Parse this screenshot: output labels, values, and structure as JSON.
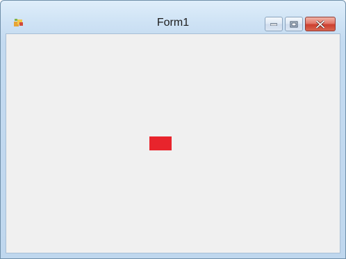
{
  "window": {
    "title": "Form1"
  },
  "icons": {
    "app": "app-icon",
    "minimize": "minimize-icon",
    "maximize": "maximize-icon",
    "close": "close-icon"
  },
  "colors": {
    "red_rectangle": "#e8242c",
    "client_background": "#f0f0f0",
    "close_button": "#cc3f2f"
  }
}
